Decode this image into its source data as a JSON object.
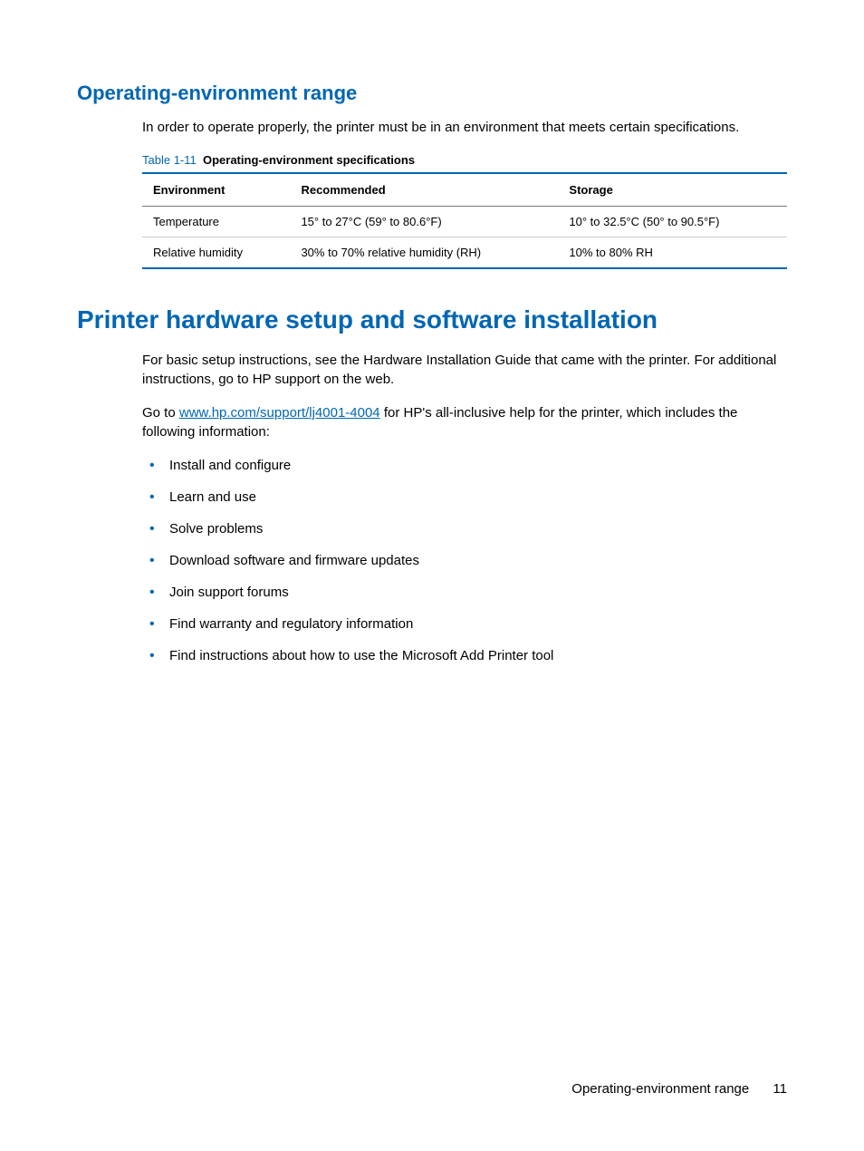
{
  "section1": {
    "heading": "Operating-environment range",
    "intro": "In order to operate properly, the printer must be in an environment that meets certain specifications.",
    "table": {
      "caption_num": "Table 1-11",
      "caption_title": "Operating-environment specifications",
      "headers": [
        "Environment",
        "Recommended",
        "Storage"
      ],
      "rows": [
        [
          "Temperature",
          "15° to 27°C (59° to 80.6°F)",
          "10° to 32.5°C (50° to 90.5°F)"
        ],
        [
          "Relative humidity",
          "30% to 70% relative humidity (RH)",
          "10% to 80% RH"
        ]
      ]
    }
  },
  "section2": {
    "heading": "Printer hardware setup and software installation",
    "para1": "For basic setup instructions, see the Hardware Installation Guide that came with the printer. For additional instructions, go to HP support on the web.",
    "para2_pre": "Go to ",
    "para2_link": "www.hp.com/support/lj4001-4004",
    "para2_post": " for HP's all-inclusive help for the printer, which includes the following information:",
    "bullets": [
      "Install and configure",
      "Learn and use",
      "Solve problems",
      "Download software and firmware updates",
      "Join support forums",
      "Find warranty and regulatory information",
      "Find instructions about how to use the Microsoft Add Printer tool"
    ]
  },
  "footer": {
    "title": "Operating-environment range",
    "page": "11"
  }
}
